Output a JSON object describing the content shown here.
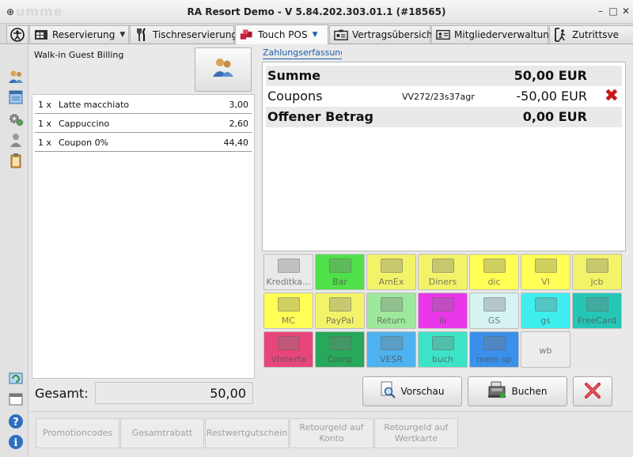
{
  "window": {
    "ghost_label": "umme",
    "title": "RA Resort Demo - V 5.84.202.303.01.1 (#18565)",
    "controls": [
      "–",
      "□",
      "✕"
    ]
  },
  "tabs": [
    {
      "label": "Reservierung",
      "icon": "calendar-icon",
      "has_dropdown": true
    },
    {
      "label": "Tischreservierung",
      "icon": "cutlery-icon",
      "has_dropdown": false
    },
    {
      "label": "Touch POS",
      "icon": "pos-cubes-icon",
      "has_dropdown": true,
      "active": true
    },
    {
      "label": "Vertragsübersicht",
      "icon": "contract-icon",
      "has_dropdown": false
    },
    {
      "label": "Mitgliederverwaltung",
      "icon": "members-card-icon",
      "has_dropdown": false
    },
    {
      "label": "Zutrittsve",
      "icon": "access-icon",
      "has_dropdown": false
    }
  ],
  "left_panel": {
    "title": "Walk-in Guest Billing",
    "lines": [
      {
        "qty": "1 x",
        "name": "Latte macchiato",
        "price": "3,00"
      },
      {
        "qty": "1 x",
        "name": "Cappuccino",
        "price": "2,60"
      },
      {
        "qty": "1 x",
        "name": "Coupon 0%",
        "price": "44,40"
      }
    ],
    "total_label": "Gesamt:",
    "total_value": "50,00"
  },
  "payment": {
    "tab_label": "Zahlungserfassung",
    "summary": {
      "sum_label": "Summe",
      "sum_value": "50,00 EUR",
      "coupon_label": "Coupons",
      "coupon_code": "VV272/23s37agr",
      "coupon_value": "-50,00 EUR",
      "open_label": "Offener Betrag",
      "open_value": "0,00 EUR"
    },
    "methods": [
      {
        "label": "Kreditka...",
        "color": "#e9e9e9"
      },
      {
        "label": "Bar",
        "color": "#4fe04a"
      },
      {
        "label": "AmEx",
        "color": "#f3f36a"
      },
      {
        "label": "Diners",
        "color": "#f3f36a"
      },
      {
        "label": "dic",
        "color": "#ffff55"
      },
      {
        "label": "VI",
        "color": "#ffff55"
      },
      {
        "label": "jcb",
        "color": "#f3f36a"
      },
      {
        "label": "MC",
        "color": "#ffff55"
      },
      {
        "label": "PayPal",
        "color": "#f3f36a"
      },
      {
        "label": "Return",
        "color": "#9de89c"
      },
      {
        "label": "iii",
        "color": "#ea37ea"
      },
      {
        "label": "GS",
        "color": "#d5f3f3"
      },
      {
        "label": "gs",
        "color": "#3fefef"
      },
      {
        "label": "FreeCard",
        "color": "#26c6b6"
      },
      {
        "label": "VInterfa",
        "color": "#e8467a"
      },
      {
        "label": "Comp",
        "color": "#27a85a"
      },
      {
        "label": "VESR",
        "color": "#4db2ef"
      },
      {
        "label": "buch",
        "color": "#3de3c6"
      },
      {
        "label": "mem sp",
        "color": "#3a90ea"
      },
      {
        "label": "wb",
        "color": "#ececec"
      }
    ],
    "preview_label": "Vorschau",
    "book_label": "Buchen"
  },
  "bottom_toolbar": [
    "Promotioncodes",
    "Gesamtrabatt",
    "Restwertgutschein",
    "Retourgeld auf Konto",
    "Retourgeld auf Wertkarte"
  ]
}
